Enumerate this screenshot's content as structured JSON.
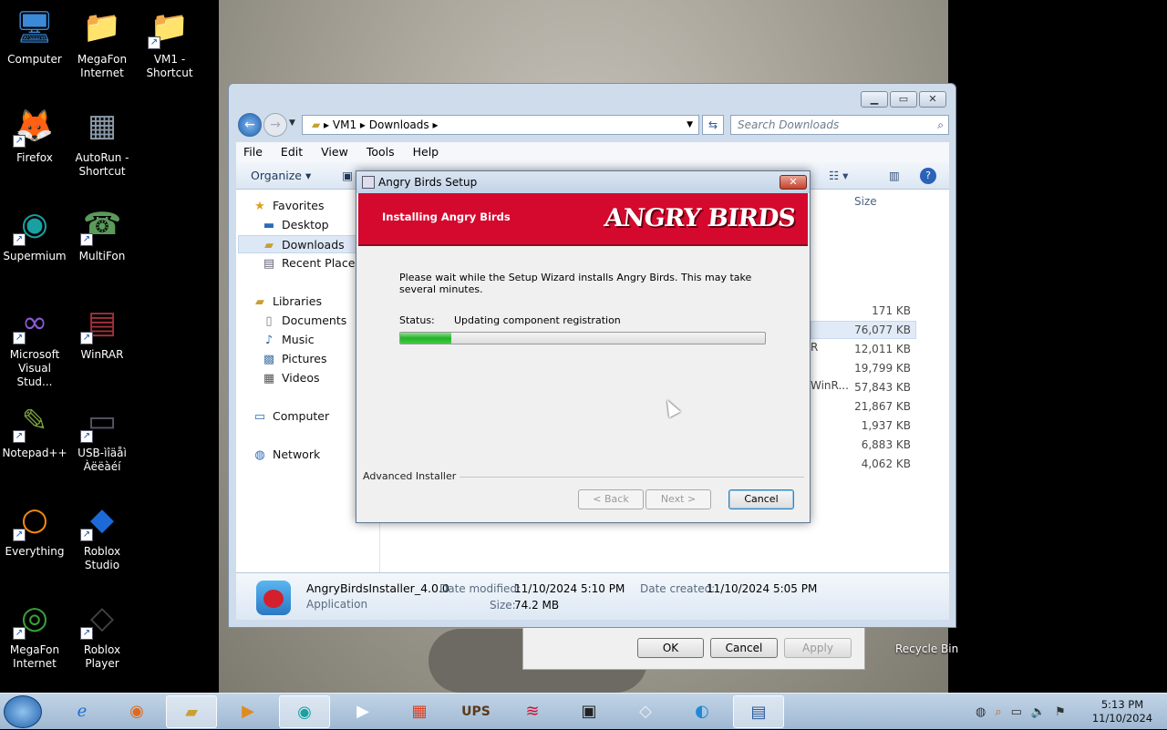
{
  "desktop": {
    "icons": [
      {
        "name": "Computer",
        "label": "Computer",
        "glyph": "🖥"
      },
      {
        "name": "MegaFon Internet folder",
        "label": "MegaFon\nInternet",
        "glyph": "📁"
      },
      {
        "name": "VM1 shortcut",
        "label": "VM1 -\nShortcut",
        "glyph": "📁"
      },
      {
        "name": "Firefox",
        "label": "Firefox",
        "glyph": "🦊"
      },
      {
        "name": "AutoRun shortcut",
        "label": "AutoRun -\nShortcut",
        "glyph": "▦"
      },
      {
        "name": "Supermium",
        "label": "Supermium",
        "glyph": "◉"
      },
      {
        "name": "MultiFon",
        "label": "MultiFon",
        "glyph": "☎"
      },
      {
        "name": "Microsoft Visual Studio",
        "label": "Microsoft\nVisual Stud...",
        "glyph": "∞"
      },
      {
        "name": "WinRAR",
        "label": "WinRAR",
        "glyph": "▤"
      },
      {
        "name": "Notepad++",
        "label": "Notepad++",
        "glyph": "✎"
      },
      {
        "name": "USB modem",
        "label": "USB-ìîäåì\nÀëëàéí",
        "glyph": "▭"
      },
      {
        "name": "Everything",
        "label": "Everything",
        "glyph": "○"
      },
      {
        "name": "Roblox Studio",
        "label": "Roblox\nStudio",
        "glyph": "◆"
      },
      {
        "name": "MegaFon Internet app",
        "label": "MegaFon\nInternet",
        "glyph": "◎"
      },
      {
        "name": "Roblox Player",
        "label": "Roblox Player",
        "glyph": "◇"
      }
    ],
    "recycle_bin": "Recycle Bin"
  },
  "explorer": {
    "address": [
      "VM1",
      "Downloads"
    ],
    "search_placeholder": "Search Downloads",
    "menu": [
      "File",
      "Edit",
      "View",
      "Tools",
      "Help"
    ],
    "organize": "Organize ▾",
    "nav": {
      "favorites": "Favorites",
      "desktop": "Desktop",
      "downloads": "Downloads",
      "recent": "Recent Places",
      "libraries": "Libraries",
      "documents": "Documents",
      "music": "Music",
      "pictures": "Pictures",
      "videos": "Videos",
      "computer": "Computer",
      "network": "Network"
    },
    "size_header": "Size",
    "sizes": [
      "171 KB",
      "76,077 KB",
      "12,011 KB",
      "19,799 KB",
      "57,843 KB",
      "21,867 KB",
      "1,937 KB",
      "6,883 KB",
      "4,062 KB"
    ],
    "fragments": {
      "r": "R",
      "winr": "WinR..."
    },
    "details": {
      "filename": "AngryBirdsInstaller_4.0.0",
      "type": "Application",
      "modified_label": "Date modified:",
      "modified": "11/10/2024 5:10 PM",
      "created_label": "Date created:",
      "created": "11/10/2024 5:05 PM",
      "size_label": "Size:",
      "size": "74.2 MB"
    }
  },
  "properties": {
    "ok": "OK",
    "cancel": "Cancel",
    "apply": "Apply"
  },
  "setup": {
    "title": "Angry Birds Setup",
    "banner_title": "Installing Angry Birds",
    "logo": "ANGRY BIRDS",
    "message": "Please wait while the Setup Wizard installs Angry Birds.  This may take several minutes.",
    "status_label": "Status:",
    "status_value": "Updating component registration",
    "progress": 0.14,
    "installer_label": "Advanced Installer",
    "back": "< Back",
    "next": "Next >",
    "cancel": "Cancel"
  },
  "taskbar": {
    "clock_time": "5:13 PM",
    "clock_date": "11/10/2024"
  }
}
